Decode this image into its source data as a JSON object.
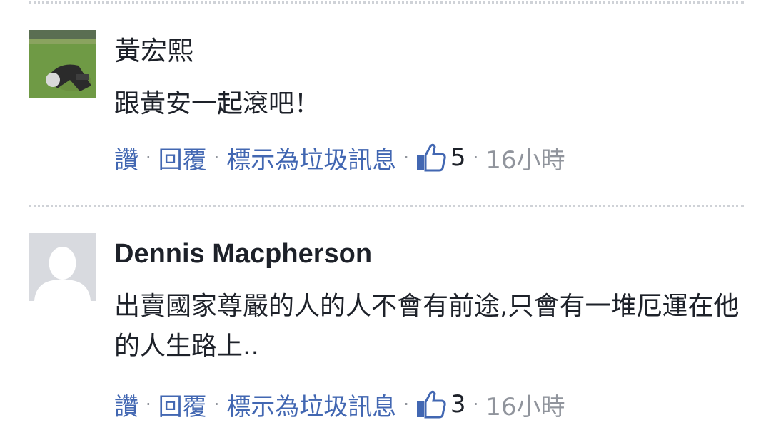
{
  "comments": [
    {
      "author": "黃宏熙",
      "text": "跟黃安一起滾吧！",
      "actions": {
        "like": "讚",
        "reply": "回覆",
        "spam": "標示為垃圾訊息"
      },
      "like_count": "5",
      "time": "16小時"
    },
    {
      "author": "Dennis Macpherson",
      "text": "出賣國家尊嚴的人的人不會有前途,只會有一堆厄運在他的人生路上..",
      "actions": {
        "like": "讚",
        "reply": "回覆",
        "spam": "標示為垃圾訊息"
      },
      "like_count": "3",
      "time": "16小時"
    }
  ],
  "separator": "·",
  "colors": {
    "link": "#4267b2",
    "meta": "#90949c",
    "text": "#1d2129"
  },
  "icons": {
    "like": "thumbs-up-icon",
    "placeholder_avatar": "default-user-silhouette"
  }
}
